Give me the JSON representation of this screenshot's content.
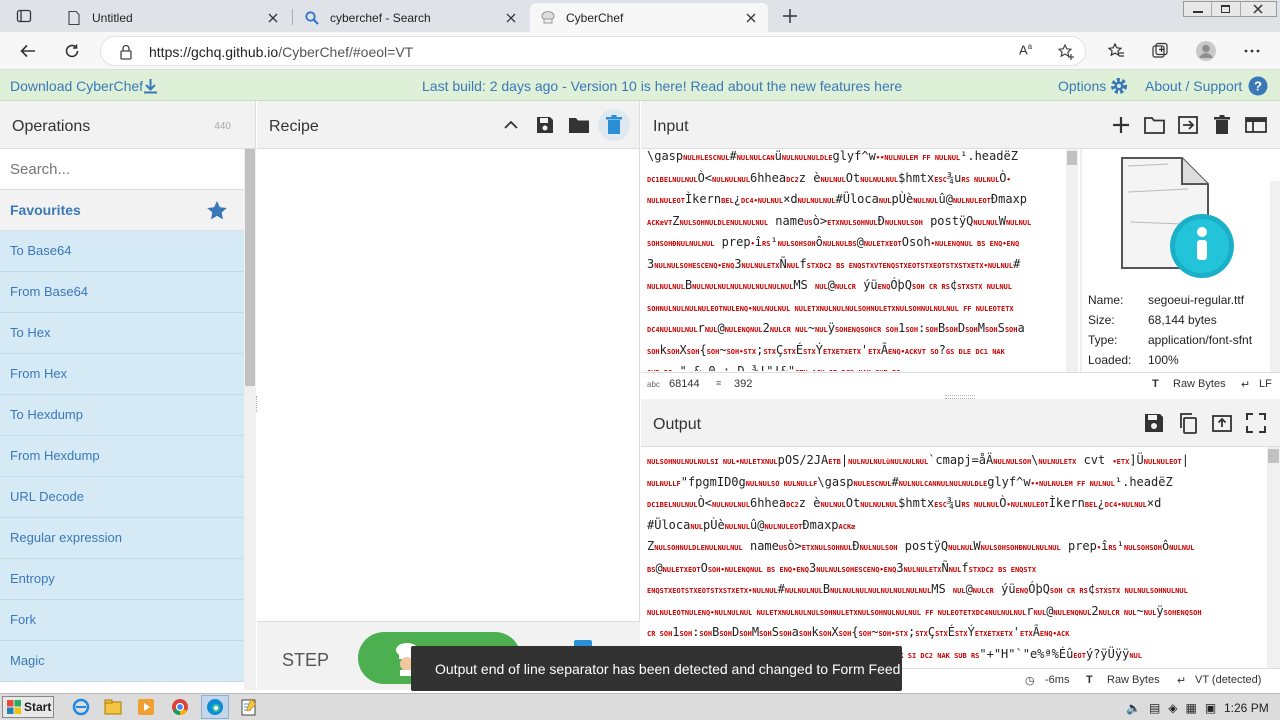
{
  "browser": {
    "tabs": [
      {
        "label": "Untitled"
      },
      {
        "label": "cyberchef - Search"
      },
      {
        "label": "CyberChef"
      }
    ],
    "url_host": "https://gchq.github.io",
    "url_path": "/CyberChef/#oeol=VT"
  },
  "banner": {
    "download": "Download CyberChef",
    "build": "Last build: 2 days ago - Version 10 is here! Read about the new features here",
    "options": "Options",
    "about": "About / Support"
  },
  "operations": {
    "title": "Operations",
    "count": "440",
    "search_placeholder": "Search...",
    "favourites": "Favourites",
    "items": [
      "To Base64",
      "From Base64",
      "To Hex",
      "From Hex",
      "To Hexdump",
      "From Hexdump",
      "URL Decode",
      "Regular expression",
      "Entropy",
      "Fork",
      "Magic"
    ]
  },
  "recipe": {
    "title": "Recipe",
    "step": "STEP"
  },
  "input": {
    "title": "Input",
    "status_length": "68144",
    "status_lines": "392",
    "raw_bytes": "Raw Bytes",
    "eol": "LF",
    "lines": [
      "\\gasp",
      "#",
      "glyf^w",
      "¹.headëZ",
      "Ò<",
      "6hhea",
      "z  è",
      "Ot",
      "$hmtx",
      "¾u",
      "Ò",
      "Ìkern",
      "×d",
      "#Üloca",
      "pÙè",
      "û@",
      "Ðmaxp",
      "Z",
      "name",
      "ò>",
      "Ð",
      "postÿQ",
      "W",
      "prep",
      "î",
      "ô",
      "@"
    ],
    "file": {
      "name_label": "Name:",
      "name": "segoeui-regular.ttf",
      "size_label": "Size:",
      "size": "68,144 bytes",
      "type_label": "Type:",
      "type": "application/font-sfnt",
      "loaded_label": "Loaded:",
      "loaded": "100%"
    }
  },
  "output": {
    "title": "Output",
    "time": "-6ms",
    "raw_bytes": "Raw Bytes",
    "eol": "VT (detected)"
  },
  "toast": "Output end of line separator has been detected and changed to Form Feed",
  "taskbar": {
    "start": "Start",
    "time": "1:26 PM"
  }
}
